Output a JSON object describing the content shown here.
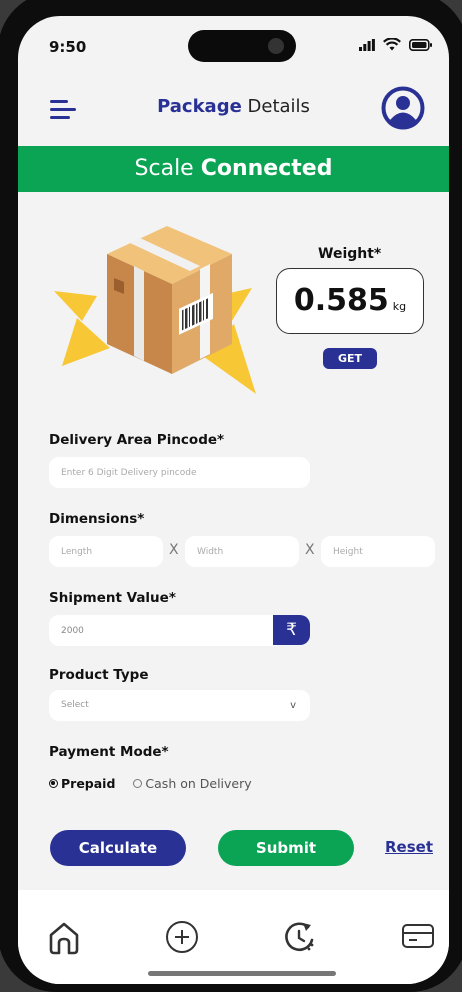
{
  "status_bar": {
    "time": "9:50"
  },
  "header": {
    "title_bold": "Package",
    "title_rest": " Details"
  },
  "banner": {
    "prefix": "Scale ",
    "status": "Connected"
  },
  "weight": {
    "label": "Weight*",
    "value": "0.585",
    "unit": "kg",
    "get_label": "GET"
  },
  "form": {
    "pincode": {
      "label": "Delivery Area Pincode*",
      "placeholder": "Enter 6 Digit Delivery pincode"
    },
    "dimensions": {
      "label": "Dimensions*",
      "length_placeholder": "Length",
      "width_placeholder": "Width",
      "height_placeholder": "Height",
      "separator": "X"
    },
    "shipment_value": {
      "label": "Shipment Value*",
      "value": "2000",
      "currency_symbol": "₹"
    },
    "product_type": {
      "label": "Product Type",
      "selected": "Select",
      "chevron": "v"
    },
    "payment_mode": {
      "label": "Payment Mode*",
      "options": [
        "Prepaid",
        "Cash on Delivery"
      ],
      "selected": "Prepaid"
    }
  },
  "actions": {
    "calculate": "Calculate",
    "submit": "Submit",
    "reset": "Reset"
  },
  "bottom_nav": [
    "home-icon",
    "add-circle-icon",
    "history-icon",
    "card-icon"
  ],
  "colors": {
    "primary": "#2a3194",
    "success": "#0aa454",
    "background": "#f3f3f4"
  }
}
